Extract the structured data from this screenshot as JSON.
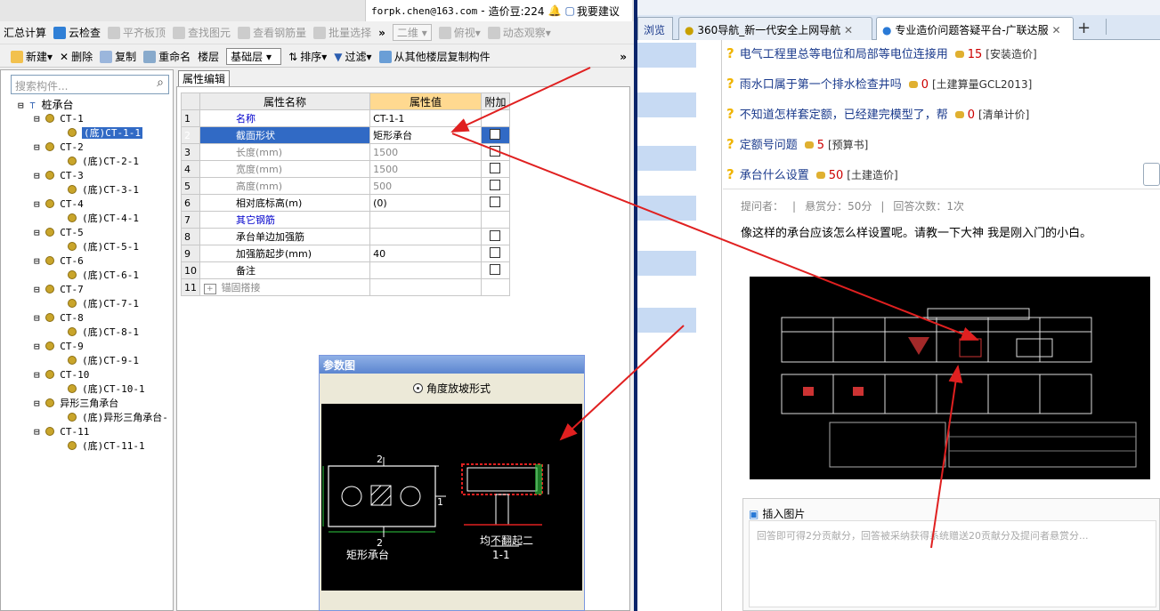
{
  "topbar": {
    "email": "forpk.chen@163.com",
    "price_label": "造价豆:224",
    "suggest_label": "我要建议"
  },
  "toolbar1": {
    "items": [
      {
        "label": "汇总计算",
        "disabled": false
      },
      {
        "label": "云检查",
        "disabled": false
      },
      {
        "label": "平齐板顶",
        "disabled": true
      },
      {
        "label": "查找图元",
        "disabled": true
      },
      {
        "label": "查看钢筋量",
        "disabled": true
      },
      {
        "label": "批量选择",
        "disabled": true
      },
      {
        "label": "二维",
        "disabled": true
      },
      {
        "label": "俯视",
        "disabled": true
      },
      {
        "label": "动态观察",
        "disabled": true
      }
    ]
  },
  "toolbar2": {
    "new_label": "新建",
    "delete_label": "删除",
    "copy_label": "复制",
    "rename_label": "重命名",
    "floor_label": "楼层",
    "floor_value": "基础层",
    "sort_label": "排序",
    "filter_label": "过滤",
    "copy_from_label": "从其他楼层复制构件"
  },
  "tree": {
    "search_placeholder": "搜索构件...",
    "root": "桩承台",
    "nodes": [
      {
        "label": "CT-1",
        "child": "(底)CT-1-1"
      },
      {
        "label": "CT-2",
        "child": "(底)CT-2-1"
      },
      {
        "label": "CT-3",
        "child": "(底)CT-3-1"
      },
      {
        "label": "CT-4",
        "child": "(底)CT-4-1"
      },
      {
        "label": "CT-5",
        "child": "(底)CT-5-1"
      },
      {
        "label": "CT-6",
        "child": "(底)CT-6-1"
      },
      {
        "label": "CT-7",
        "child": "(底)CT-7-1"
      },
      {
        "label": "CT-8",
        "child": "(底)CT-8-1"
      },
      {
        "label": "CT-9",
        "child": "(底)CT-9-1"
      },
      {
        "label": "CT-10",
        "child": "(底)CT-10-1"
      },
      {
        "label": "异形三角承台",
        "child": "(底)异形三角承台-"
      },
      {
        "label": "CT-11",
        "child": "(底)CT-11-1"
      }
    ]
  },
  "props": {
    "tab_label": "属性编辑",
    "col_name": "属性名称",
    "col_value": "属性值",
    "col_extra": "附加",
    "rows": [
      {
        "idx": "1",
        "name": "名称",
        "value": "CT-1-1",
        "style": "blue",
        "check": false
      },
      {
        "idx": "2",
        "name": "截面形状",
        "value": "矩形承台",
        "style": "sel",
        "check": true
      },
      {
        "idx": "3",
        "name": "长度(mm)",
        "value": "1500",
        "style": "gray",
        "check": true
      },
      {
        "idx": "4",
        "name": "宽度(mm)",
        "value": "1500",
        "style": "gray",
        "check": true
      },
      {
        "idx": "5",
        "name": "高度(mm)",
        "value": "500",
        "style": "gray",
        "check": true
      },
      {
        "idx": "6",
        "name": "相对底标高(m)",
        "value": "(0)",
        "style": "",
        "check": true
      },
      {
        "idx": "7",
        "name": "其它钢筋",
        "value": "",
        "style": "blue",
        "check": false
      },
      {
        "idx": "8",
        "name": "承台单边加强筋",
        "value": "",
        "style": "",
        "check": true
      },
      {
        "idx": "9",
        "name": "加强筋起步(mm)",
        "value": "40",
        "style": "",
        "check": true
      },
      {
        "idx": "10",
        "name": "备注",
        "value": "",
        "style": "",
        "check": true
      },
      {
        "idx": "11",
        "name": "锚固搭接",
        "value": "",
        "style": "gray",
        "check": false
      }
    ]
  },
  "popup": {
    "title": "参数图",
    "radio_label": "角度放坡形式",
    "shape_label": "矩形承台",
    "section_label": "均不翻起二",
    "section_id": "1-1",
    "dim_1": "2",
    "dim_2": "1"
  },
  "browser": {
    "tabs": [
      {
        "label": "浏览"
      },
      {
        "label": "360导航_新一代安全上网导航"
      },
      {
        "label": "专业造价问题答疑平台-广联达服"
      }
    ]
  },
  "questions": [
    {
      "title": "电气工程里总等电位和局部等电位连接用",
      "points": "15",
      "tag": "[安装造价]"
    },
    {
      "title": "雨水口属于第一个排水检查井吗",
      "points": "0",
      "tag": "[土建算量GCL2013]"
    },
    {
      "title": "不知道怎样套定额，已经建完模型了，帮",
      "points": "0",
      "tag": "[清单计价]"
    },
    {
      "title": "定额号问题",
      "points": "5",
      "tag": "[预算书]"
    },
    {
      "title": "承台什么设置",
      "points": "50",
      "tag": "[土建造价]"
    }
  ],
  "qdetail": {
    "asker_label": "提问者：",
    "reward": "悬赏分：50分",
    "answers": "回答次数：1次",
    "body": "像这样的承台应该怎么样设置呢。请教一下大神 我是刚入门的小白。"
  },
  "answerbox": {
    "insert_image": "插入图片",
    "placeholder": "回答即可得2分贡献分，回答被采纳获得系统赠送20贡献分及提问者悬赏分..."
  },
  "colors": {
    "arrow": "#e02020",
    "selection": "#316ac5",
    "value_header": "#ffd990"
  }
}
